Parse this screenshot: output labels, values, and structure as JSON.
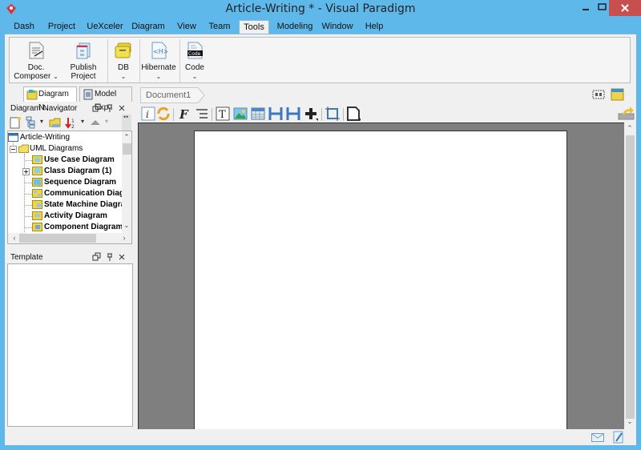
{
  "window": {
    "title": "Article-Writing * - Visual Paradigm",
    "minimize_icon": "minimize-icon",
    "maximize_icon": "maximize-icon",
    "close_icon": "close-icon"
  },
  "menu": {
    "items": [
      {
        "label": "Dash"
      },
      {
        "label": "Project"
      },
      {
        "label": "UeXceler"
      },
      {
        "label": "Diagram"
      },
      {
        "label": "View"
      },
      {
        "label": "Team"
      },
      {
        "label": "Tools",
        "active": true
      },
      {
        "label": "Modeling"
      },
      {
        "label": "Window"
      },
      {
        "label": "Help"
      }
    ]
  },
  "ribbon": {
    "buttons": [
      {
        "label1": "Doc.",
        "label2": "Composer",
        "icon": "doc-composer-icon",
        "has_dropdown": true
      },
      {
        "label1": "Publish",
        "label2": "Project",
        "icon": "publish-project-icon",
        "has_dropdown": false
      },
      {
        "label1": "DB",
        "label2": "",
        "icon": "database-icon",
        "has_dropdown": true
      },
      {
        "label1": "Hibernate",
        "label2": "",
        "icon": "hibernate-icon",
        "has_dropdown": true
      },
      {
        "label1": "Code",
        "label2": "",
        "icon": "code-icon",
        "has_dropdown": true
      }
    ],
    "dropdown_glyph": "⌄"
  },
  "left_tabs": [
    {
      "label": "Diagram N..",
      "active": true
    },
    {
      "label": "Model Exp..",
      "active": false
    }
  ],
  "diagram_navigator": {
    "title": "Diagram Navigator",
    "tree": [
      {
        "label": "Article-Writing",
        "level": 0,
        "bold": false,
        "icon": "project-icon"
      },
      {
        "label": "UML Diagrams",
        "level": 1,
        "bold": false,
        "icon": "folder-icon",
        "expanded": true
      },
      {
        "label": "Use Case Diagram",
        "level": 2,
        "bold": true,
        "icon": "use-case-diagram-icon"
      },
      {
        "label": "Class Diagram (1)",
        "level": 2,
        "bold": true,
        "icon": "class-diagram-icon",
        "expandable": true
      },
      {
        "label": "Sequence Diagram",
        "level": 2,
        "bold": true,
        "icon": "sequence-diagram-icon"
      },
      {
        "label": "Communication Diagram",
        "level": 2,
        "bold": true,
        "icon": "communication-diagram-icon"
      },
      {
        "label": "State Machine Diagram",
        "level": 2,
        "bold": true,
        "icon": "state-machine-diagram-icon"
      },
      {
        "label": "Activity Diagram",
        "level": 2,
        "bold": true,
        "icon": "activity-diagram-icon"
      },
      {
        "label": "Component Diagram",
        "level": 2,
        "bold": true,
        "icon": "component-diagram-icon"
      }
    ]
  },
  "template_panel": {
    "title": "Template"
  },
  "document": {
    "tab_label": "Document1"
  },
  "colors": {
    "window_frame": "#5eb8ea",
    "close_button": "#c7504f",
    "canvas_bg": "#7f7f7f",
    "panel_bg": "#f0f0f0"
  }
}
